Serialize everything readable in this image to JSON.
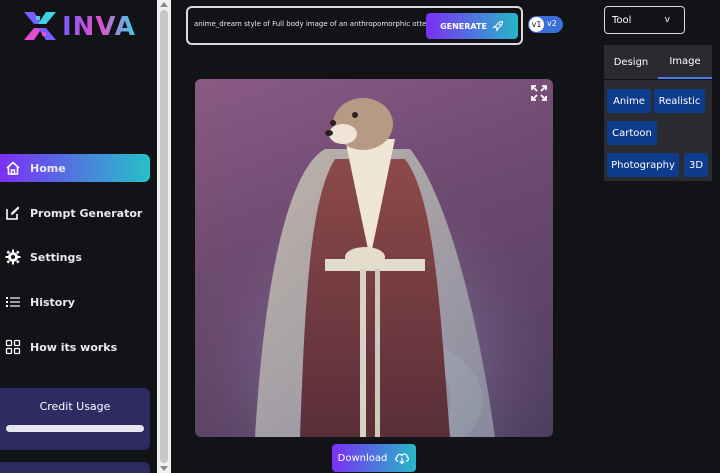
{
  "brand": {
    "name": "INVA"
  },
  "sidebar": {
    "items": [
      {
        "label": "Home",
        "icon": "home-icon",
        "active": true
      },
      {
        "label": "Prompt Generator",
        "icon": "edit-icon",
        "active": false
      },
      {
        "label": "Settings",
        "icon": "gear-icon",
        "active": false
      },
      {
        "label": "History",
        "icon": "list-icon",
        "active": false
      },
      {
        "label": "How its works",
        "icon": "grid-icon",
        "active": false
      }
    ],
    "credit_title": "Credit Usage"
  },
  "prompt": {
    "text": "anime_dream style of Full body image of an anthropomorphic otter",
    "generate_label": "GENERATE"
  },
  "version": {
    "v1": "v1",
    "v2": "v2"
  },
  "image": {
    "alt": "anthropomorphic otter in robes"
  },
  "download_label": "Download",
  "tool_select": {
    "value": "Tool",
    "caret": "v"
  },
  "tabs": [
    {
      "label": "Design"
    },
    {
      "label": "Image"
    }
  ],
  "styles": [
    "Anime",
    "Realistic",
    "Cartoon",
    "Photography",
    "3D"
  ],
  "colors": {
    "accent_start": "#7b2ff7",
    "accent_end": "#25c1c7",
    "chip": "#0f3b8c",
    "background": "#121316"
  }
}
